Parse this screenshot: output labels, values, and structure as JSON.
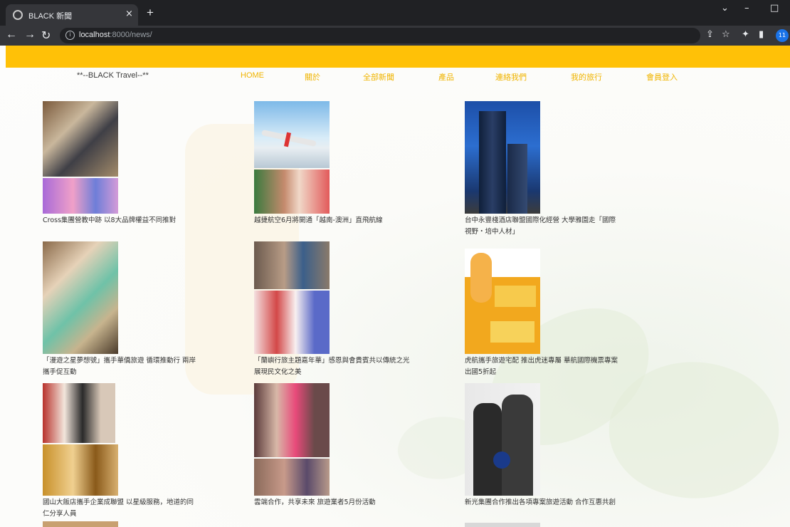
{
  "browser": {
    "tab_title": "BLACK 新聞",
    "tab_close": "×",
    "new_tab": "+",
    "url_host": "localhost",
    "url_rest": ":8000/news/",
    "profile_initials": "11"
  },
  "navbar": {
    "brand": "**--BLACK Travel--**",
    "links": [
      "HOME",
      "關於",
      "全部新聞",
      "產品",
      "連絡我們",
      "我的旅行",
      "會員登入"
    ],
    "bar_color": "#ffc107",
    "link_color": "#f0b400"
  },
  "news": [
    {
      "caption": "Cross集團營教中跡 以8大品牌權益不同推對"
    },
    {
      "caption": "越捷航空6月將開通「越南-澳洲」直飛航線"
    },
    {
      "caption": "台中永豐棧酒店聯盟國際化經營 大學雅園走「國際視野・培中人材」"
    },
    {
      "caption": "「漫遊之星夢想號」攜手華僑旅遊 循環推動行 兩岸攜手促互動"
    },
    {
      "caption": "「蘭嶼行旅主題嘉年華」感恩與會貴賓共以傳統之光展現民文化之美"
    },
    {
      "caption": "虎航攜手旅遊宅配 推出虎迷專屬 華航國際機票專案 出國5折起"
    },
    {
      "caption": "國山大飯店攜手企業成聯盟 以星級服務，地道的同仁分享人員"
    },
    {
      "caption": "雲端合作，共享未來 旅遊業者5月份活動"
    },
    {
      "caption": "新光集團合作推出各項專案旅遊活動 合作互惠共創"
    }
  ]
}
